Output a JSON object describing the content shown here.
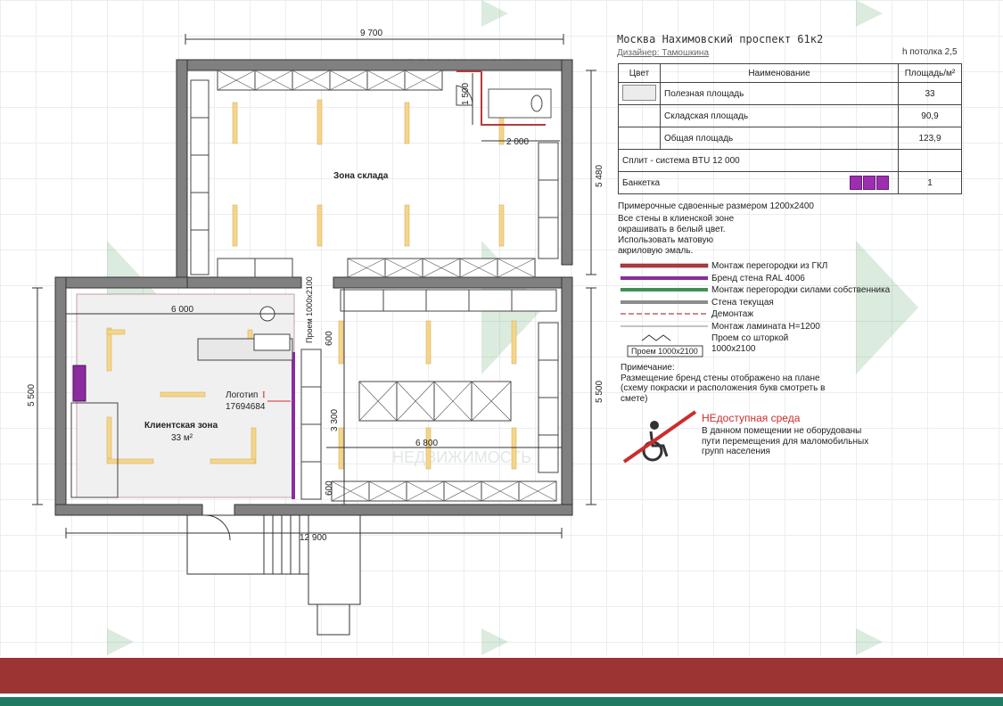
{
  "header": {
    "address": "Москва Нахимовский проспект 61к2",
    "designer": "Дизайнер: Тамошкина",
    "ceiling_height": "h потолка 2,5"
  },
  "legend_table": {
    "col_color": "Цвет",
    "col_name": "Наименование",
    "col_area": "Площадь/м²",
    "rows": [
      {
        "name": "Полезная площадь",
        "value": "33"
      },
      {
        "name": "Складская площадь",
        "value": "90,9"
      },
      {
        "name": "Общая площадь",
        "value": "123,9"
      },
      {
        "name": "Сплит - система BTU  12 000",
        "value": ""
      },
      {
        "name": "Банкетка",
        "value": "1"
      }
    ]
  },
  "notes": {
    "shelves": "Примерочные сдвоенные размером 1200х2400",
    "walls_1": "Все стены в клиенской зоне",
    "walls_2": "окрашивать в белый цвет.",
    "walls_3": "Использовать матовую",
    "walls_4": "акриловую эмаль."
  },
  "line_legend": [
    {
      "label": "Монтаж перегородки из ГКЛ",
      "color": "#b53a3a"
    },
    {
      "label": "Бренд стена RAL 4006",
      "color": "#8a2c9e"
    },
    {
      "label": "Монтаж перегородки силами собственника",
      "color": "#3f8f56"
    },
    {
      "label": "Стена текущая",
      "color": "#8c8c8c"
    },
    {
      "label": "Демонтаж",
      "color": "#d05a5a"
    },
    {
      "label": "Монтаж ламината H=1200",
      "color": "#888888"
    },
    {
      "label": "Проем со шторкой",
      "color": "#333333"
    },
    {
      "label": "1000х2100",
      "color": "#333333"
    }
  ],
  "opening_tag": "Проем 1000х2100",
  "remark": {
    "title": "Примечание:",
    "line1": "Размещение бренд стены отображено на плане",
    "line2": "(схему покраски и расположения букв смотреть в",
    "line3": "смете)"
  },
  "warning": {
    "title": "НЕдоступная среда",
    "line1": "В данном помещении не оборудованы",
    "line2": "пути перемещения для маломобильных",
    "line3": "групп населения"
  },
  "plan": {
    "dim_top": "9 700",
    "dim_1500": "1 500",
    "dim_2000": "2 000",
    "dim_5480": "5 480",
    "dim_6000": "6 000",
    "dim_5500_left": "5 500",
    "dim_5500_right": "5 500",
    "dim_6800": "6 800",
    "dim_3300": "3 300",
    "dim_12900": "12 900",
    "dim_600_a": "600",
    "dim_600_b": "600",
    "opening_vertical": "Проем 1000х2100",
    "zone_storage": "Зона склада",
    "zone_client": "Клиентская зона",
    "zone_client_area": "33 м²",
    "logo_label": "Логотип",
    "logo_code": "17694684",
    "watermark": "НЕДВИЖИМОСТЬ"
  },
  "colors": {
    "wall": "#808080",
    "shelf": "#555555",
    "lamp": "#f5d58a",
    "brand_wall": "#8a2c9e",
    "warning_red": "#cc2d2d",
    "footer_red": "#9c3433",
    "footer_green": "#1f7a62"
  }
}
